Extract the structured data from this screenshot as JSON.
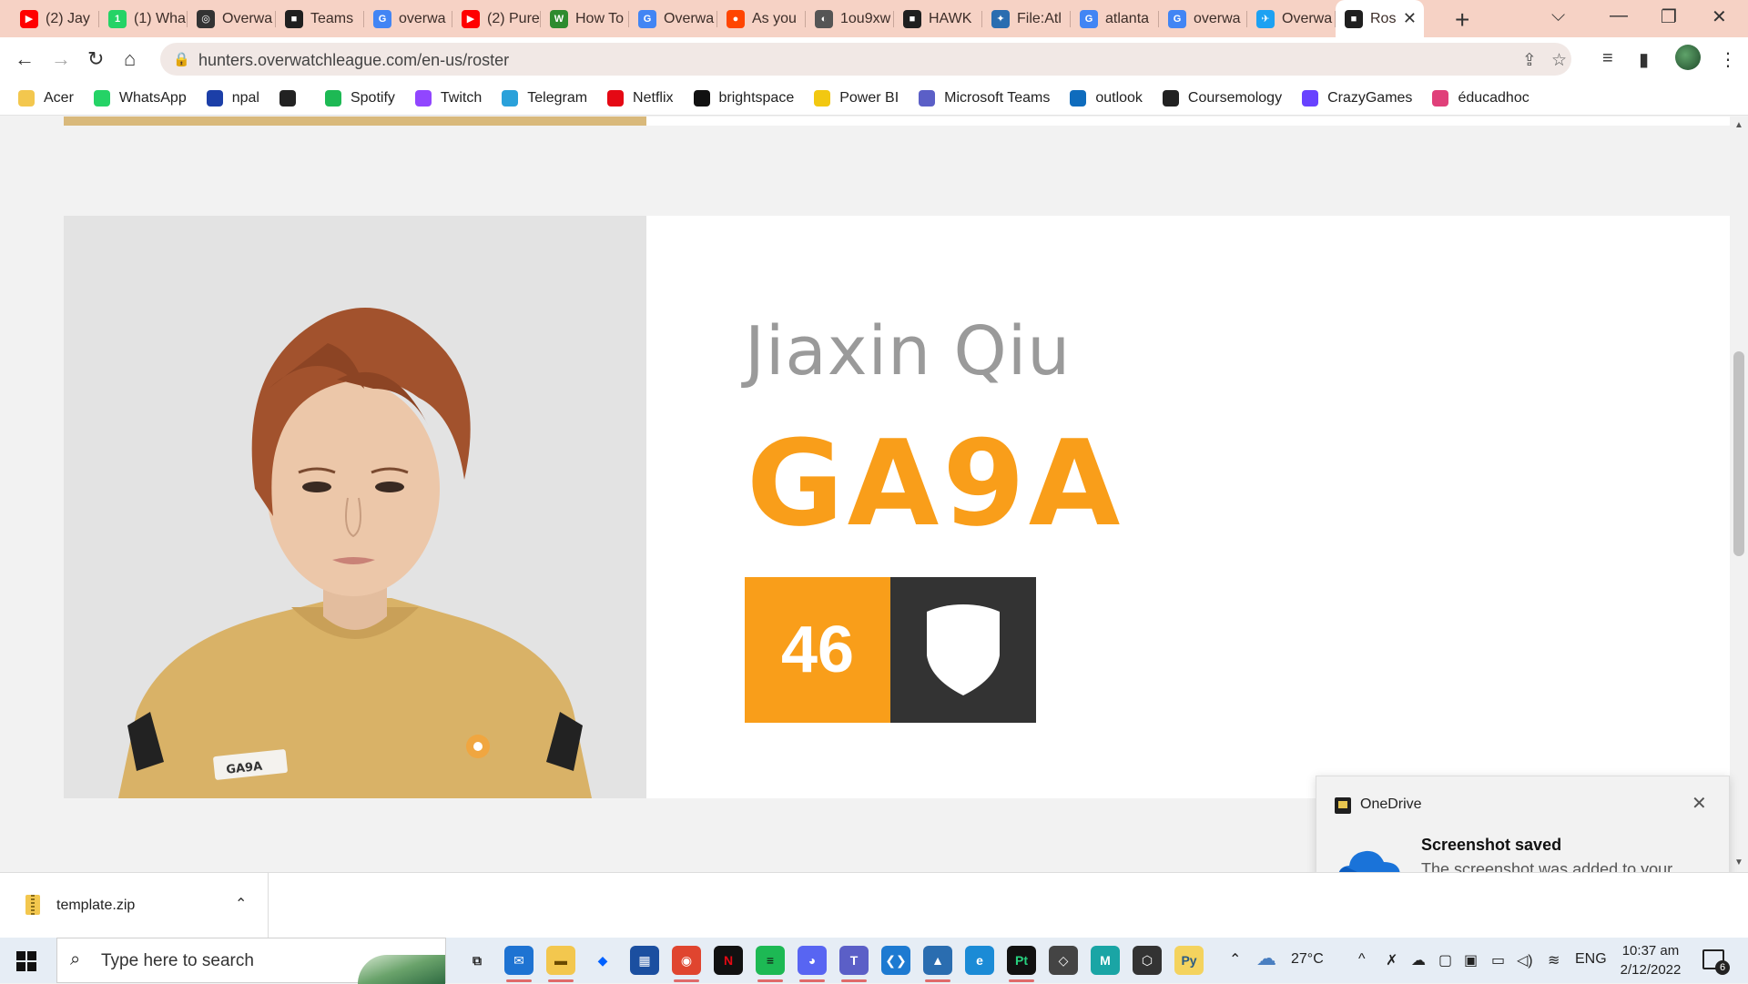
{
  "browser": {
    "tabs": [
      {
        "label": "(2) Jay",
        "icon": "youtube-icon",
        "color": "#ff0000",
        "glyph": "▶"
      },
      {
        "label": "(1) Wha",
        "icon": "whatsapp-icon",
        "color": "#25d366",
        "glyph": "1"
      },
      {
        "label": "Overwa",
        "icon": "overwatch-icon",
        "color": "#333333",
        "glyph": "◎"
      },
      {
        "label": "Teams",
        "icon": "hunters-icon",
        "color": "#1f1f1f",
        "glyph": "■"
      },
      {
        "label": "overwa",
        "icon": "google-icon",
        "color": "#4285f4",
        "glyph": "G"
      },
      {
        "label": "(2) Pure",
        "icon": "youtube-icon",
        "color": "#ff0000",
        "glyph": "▶"
      },
      {
        "label": "How To",
        "icon": "wikihow-icon",
        "color": "#2e8b2e",
        "glyph": "W"
      },
      {
        "label": "Overwa",
        "icon": "google-icon",
        "color": "#4285f4",
        "glyph": "G"
      },
      {
        "label": "As you",
        "icon": "reddit-icon",
        "color": "#ff4500",
        "glyph": "●"
      },
      {
        "label": "1ou9xw",
        "icon": "globe-icon",
        "color": "#555555",
        "glyph": "◐"
      },
      {
        "label": "HAWK",
        "icon": "hunters-icon",
        "color": "#1f1f1f",
        "glyph": "■"
      },
      {
        "label": "File:Atl",
        "icon": "wiki-icon",
        "color": "#2a6db0",
        "glyph": "✦"
      },
      {
        "label": "atlanta",
        "icon": "google-icon",
        "color": "#4285f4",
        "glyph": "G"
      },
      {
        "label": "overwa",
        "icon": "google-icon",
        "color": "#4285f4",
        "glyph": "G"
      },
      {
        "label": "Overwa",
        "icon": "twitter-icon",
        "color": "#1da1f2",
        "glyph": "✈"
      },
      {
        "label": "Ros",
        "icon": "hunters-icon",
        "color": "#1f1f1f",
        "glyph": "■",
        "active": true
      }
    ],
    "url": "hunters.overwatchleague.com/en-us/roster"
  },
  "bookmarks": [
    {
      "label": "Acer",
      "icon": "folder-icon",
      "color": "#f3c74e"
    },
    {
      "label": "WhatsApp",
      "icon": "whatsapp-icon",
      "color": "#25d366"
    },
    {
      "label": "npal",
      "icon": "npal-icon",
      "color": "#1c3fa8"
    },
    {
      "label": "",
      "icon": "globe-icon",
      "color": "#222222"
    },
    {
      "label": "Spotify",
      "icon": "spotify-icon",
      "color": "#1db954"
    },
    {
      "label": "Twitch",
      "icon": "twitch-icon",
      "color": "#9146ff"
    },
    {
      "label": "Telegram",
      "icon": "telegram-icon",
      "color": "#2aa1da"
    },
    {
      "label": "Netflix",
      "icon": "netflix-icon",
      "color": "#e50914"
    },
    {
      "label": "brightspace",
      "icon": "np-icon",
      "color": "#111111"
    },
    {
      "label": "Power BI",
      "icon": "powerbi-icon",
      "color": "#f2c811"
    },
    {
      "label": "Microsoft Teams",
      "icon": "teams-icon",
      "color": "#5b5fc7"
    },
    {
      "label": "outlook",
      "icon": "outlook-icon",
      "color": "#0f6cbd"
    },
    {
      "label": "Coursemology",
      "icon": "coursemology-icon",
      "color": "#222222"
    },
    {
      "label": "CrazyGames",
      "icon": "crazygames-icon",
      "color": "#6842ff"
    },
    {
      "label": "éducadhoc",
      "icon": "educadhoc-icon",
      "color": "#e0407a"
    }
  ],
  "player": {
    "name": "Jiaxin Qiu",
    "tag": "GA9A",
    "number": "46",
    "role_icon": "shield-icon",
    "jersey_tag": "GA9A",
    "accent": "#f99e1a",
    "dark": "#333333"
  },
  "toast": {
    "app": "OneDrive",
    "title": "Screenshot saved",
    "body": "The screenshot was added to your OneDrive."
  },
  "downloads": {
    "file": "template.zip"
  },
  "taskbar": {
    "search_placeholder": "Type here to search",
    "weather": "27°C",
    "language": "ENG",
    "time": "10:37 am",
    "date": "2/12/2022",
    "notifications": "6"
  }
}
